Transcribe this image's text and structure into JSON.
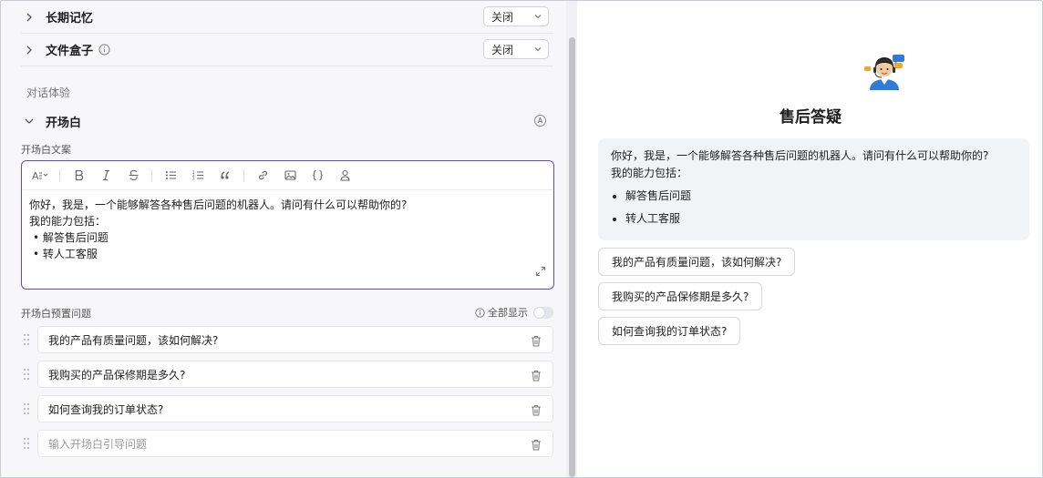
{
  "config": {
    "long_memory": {
      "label": "长期记忆",
      "value": "关闭"
    },
    "file_box": {
      "label": "文件盒子",
      "value": "关闭"
    },
    "section_label": "对话体验",
    "opening": {
      "title": "开场白",
      "badge": "A",
      "copy_label": "开场白文案",
      "text_line1": "你好，我是，一个能够解答各种售后问题的机器人。请问有什么可以帮助你的?",
      "text_line2": "我的能力包括：",
      "abilities": [
        "解答售后问题",
        "转人工客服"
      ],
      "preset_label": "开场白预置问题",
      "show_all_label": "全部显示",
      "show_all_on": false,
      "questions": [
        "我的产品有质量问题，该如何解决?",
        "我购买的产品保修期是多久?",
        "如何查询我的订单状态?"
      ],
      "new_question_placeholder": "输入开场白引导问题"
    }
  },
  "preview": {
    "bot_name": "售后答疑",
    "message_line1": "你好，我是，一个能够解答各种售后问题的机器人。请问有什么可以帮助你的?",
    "message_line2": "我的能力包括：",
    "abilities": [
      "解答售后问题",
      "转人工客服"
    ],
    "suggestions": [
      "我的产品有质量问题，该如何解决?",
      "我购买的产品保修期是多久?",
      "如何查询我的订单状态?"
    ]
  },
  "toolbar_icons": [
    "text-style-icon",
    "bold-icon",
    "italic-icon",
    "strikethrough-icon",
    "bullet-list-icon",
    "numbered-list-icon",
    "quote-icon",
    "link-icon",
    "image-icon",
    "code-braces-icon",
    "user-variable-icon"
  ],
  "colors": {
    "accent": "#5a4bd1",
    "panel_bg": "#f7f7f9"
  }
}
